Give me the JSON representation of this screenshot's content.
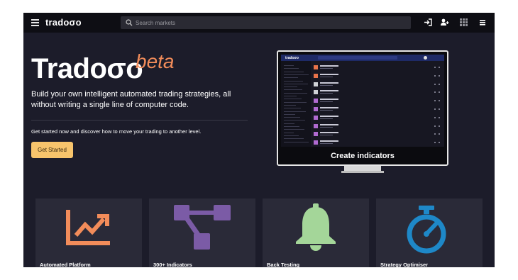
{
  "header": {
    "brand": "tradoσo",
    "search_placeholder": "Search markets",
    "icons": [
      "menu-icon",
      "search-icon",
      "sign-in-icon",
      "user-plus-icon",
      "grid-icon",
      "hamburger-icon"
    ]
  },
  "hero": {
    "title": "Tradoσo",
    "badge": "beta",
    "subtitle": "Build your own intelligent automated trading strategies, all without writing a single line of computer code.",
    "cta_text": "Get started now and discover how to move your trading to another level.",
    "button_label": "Get Started"
  },
  "showcase": {
    "caption": "Create indicators"
  },
  "features": [
    {
      "label": "Automated Platform",
      "icon": "chart-trend-icon",
      "color": "#f28c5a"
    },
    {
      "label": "300+ Indicators",
      "icon": "flow-diagram-icon",
      "color": "#7b5ba6"
    },
    {
      "label": "Back Testing",
      "icon": "bell-icon",
      "color": "#a4d699"
    },
    {
      "label": "Strategy Optimiser",
      "icon": "stopwatch-icon",
      "color": "#1e88c8"
    }
  ],
  "colors": {
    "background": "#1c1c2a",
    "topbar": "#0e0e14",
    "accent": "#f28c5a",
    "button": "#f7c46c"
  }
}
